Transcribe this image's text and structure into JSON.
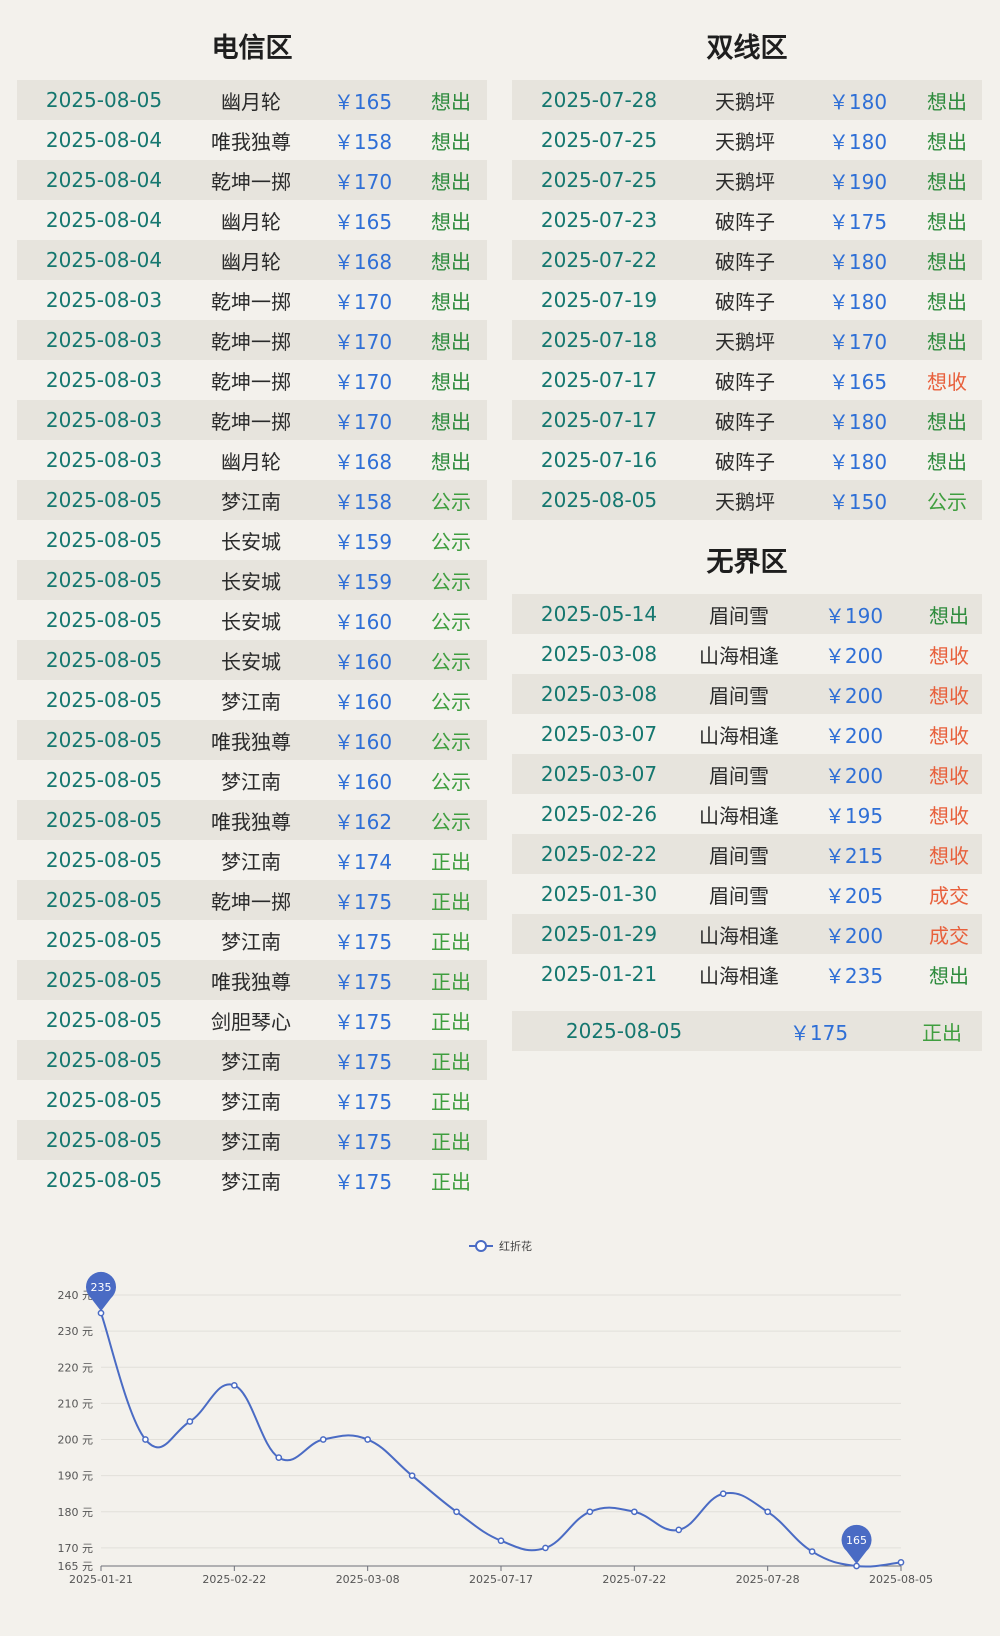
{
  "colors": {
    "date": "#15776f",
    "price": "#2f6fd6",
    "server": "#2a2a2a",
    "status_sell": "#2e8b3d",
    "status_public": "#3f9e3f",
    "status_buy": "#e8603c",
    "status_deal": "#e8603c",
    "series": "#4a6bc4"
  },
  "sections": {
    "dianxin": {
      "title": "电信区",
      "rows": [
        {
          "date": "2025-08-05",
          "server": "幽月轮",
          "price": "￥165",
          "status": "想出"
        },
        {
          "date": "2025-08-04",
          "server": "唯我独尊",
          "price": "￥158",
          "status": "想出"
        },
        {
          "date": "2025-08-04",
          "server": "乾坤一掷",
          "price": "￥170",
          "status": "想出"
        },
        {
          "date": "2025-08-04",
          "server": "幽月轮",
          "price": "￥165",
          "status": "想出"
        },
        {
          "date": "2025-08-04",
          "server": "幽月轮",
          "price": "￥168",
          "status": "想出"
        },
        {
          "date": "2025-08-03",
          "server": "乾坤一掷",
          "price": "￥170",
          "status": "想出"
        },
        {
          "date": "2025-08-03",
          "server": "乾坤一掷",
          "price": "￥170",
          "status": "想出"
        },
        {
          "date": "2025-08-03",
          "server": "乾坤一掷",
          "price": "￥170",
          "status": "想出"
        },
        {
          "date": "2025-08-03",
          "server": "乾坤一掷",
          "price": "￥170",
          "status": "想出"
        },
        {
          "date": "2025-08-03",
          "server": "幽月轮",
          "price": "￥168",
          "status": "想出"
        },
        {
          "date": "2025-08-05",
          "server": "梦江南",
          "price": "￥158",
          "status": "公示"
        },
        {
          "date": "2025-08-05",
          "server": "长安城",
          "price": "￥159",
          "status": "公示"
        },
        {
          "date": "2025-08-05",
          "server": "长安城",
          "price": "￥159",
          "status": "公示"
        },
        {
          "date": "2025-08-05",
          "server": "长安城",
          "price": "￥160",
          "status": "公示"
        },
        {
          "date": "2025-08-05",
          "server": "长安城",
          "price": "￥160",
          "status": "公示"
        },
        {
          "date": "2025-08-05",
          "server": "梦江南",
          "price": "￥160",
          "status": "公示"
        },
        {
          "date": "2025-08-05",
          "server": "唯我独尊",
          "price": "￥160",
          "status": "公示"
        },
        {
          "date": "2025-08-05",
          "server": "梦江南",
          "price": "￥160",
          "status": "公示"
        },
        {
          "date": "2025-08-05",
          "server": "唯我独尊",
          "price": "￥162",
          "status": "公示"
        },
        {
          "date": "2025-08-05",
          "server": "梦江南",
          "price": "￥174",
          "status": "正出"
        },
        {
          "date": "2025-08-05",
          "server": "乾坤一掷",
          "price": "￥175",
          "status": "正出"
        },
        {
          "date": "2025-08-05",
          "server": "梦江南",
          "price": "￥175",
          "status": "正出"
        },
        {
          "date": "2025-08-05",
          "server": "唯我独尊",
          "price": "￥175",
          "status": "正出"
        },
        {
          "date": "2025-08-05",
          "server": "剑胆琴心",
          "price": "￥175",
          "status": "正出"
        },
        {
          "date": "2025-08-05",
          "server": "梦江南",
          "price": "￥175",
          "status": "正出"
        },
        {
          "date": "2025-08-05",
          "server": "梦江南",
          "price": "￥175",
          "status": "正出"
        },
        {
          "date": "2025-08-05",
          "server": "梦江南",
          "price": "￥175",
          "status": "正出"
        },
        {
          "date": "2025-08-05",
          "server": "梦江南",
          "price": "￥175",
          "status": "正出"
        }
      ]
    },
    "shuangxian": {
      "title": "双线区",
      "rows": [
        {
          "date": "2025-07-28",
          "server": "天鹅坪",
          "price": "￥180",
          "status": "想出"
        },
        {
          "date": "2025-07-25",
          "server": "天鹅坪",
          "price": "￥180",
          "status": "想出"
        },
        {
          "date": "2025-07-25",
          "server": "天鹅坪",
          "price": "￥190",
          "status": "想出"
        },
        {
          "date": "2025-07-23",
          "server": "破阵子",
          "price": "￥175",
          "status": "想出"
        },
        {
          "date": "2025-07-22",
          "server": "破阵子",
          "price": "￥180",
          "status": "想出"
        },
        {
          "date": "2025-07-19",
          "server": "破阵子",
          "price": "￥180",
          "status": "想出"
        },
        {
          "date": "2025-07-18",
          "server": "天鹅坪",
          "price": "￥170",
          "status": "想出"
        },
        {
          "date": "2025-07-17",
          "server": "破阵子",
          "price": "￥165",
          "status": "想收"
        },
        {
          "date": "2025-07-17",
          "server": "破阵子",
          "price": "￥180",
          "status": "想出"
        },
        {
          "date": "2025-07-16",
          "server": "破阵子",
          "price": "￥180",
          "status": "想出"
        },
        {
          "date": "2025-08-05",
          "server": "天鹅坪",
          "price": "￥150",
          "status": "公示"
        }
      ]
    },
    "wujie": {
      "title": "无界区",
      "rows": [
        {
          "date": "2025-05-14",
          "server": "眉间雪",
          "price": "￥190",
          "status": "想出"
        },
        {
          "date": "2025-03-08",
          "server": "山海相逢",
          "price": "￥200",
          "status": "想收"
        },
        {
          "date": "2025-03-08",
          "server": "眉间雪",
          "price": "￥200",
          "status": "想收"
        },
        {
          "date": "2025-03-07",
          "server": "山海相逢",
          "price": "￥200",
          "status": "想收"
        },
        {
          "date": "2025-03-07",
          "server": "眉间雪",
          "price": "￥200",
          "status": "想收"
        },
        {
          "date": "2025-02-26",
          "server": "山海相逢",
          "price": "￥195",
          "status": "想收"
        },
        {
          "date": "2025-02-22",
          "server": "眉间雪",
          "price": "￥215",
          "status": "想收"
        },
        {
          "date": "2025-01-30",
          "server": "眉间雪",
          "price": "￥205",
          "status": "成交"
        },
        {
          "date": "2025-01-29",
          "server": "山海相逢",
          "price": "￥200",
          "status": "成交"
        },
        {
          "date": "2025-01-21",
          "server": "山海相逢",
          "price": "￥235",
          "status": "想出"
        }
      ],
      "summary": {
        "date": "2025-08-05",
        "price": "￥175",
        "status": "正出"
      }
    }
  },
  "chart_data": {
    "type": "line",
    "legend": [
      "红折花"
    ],
    "legend_position": "top-center",
    "series": [
      {
        "name": "红折花",
        "values": [
          235,
          200,
          205,
          215,
          195,
          200,
          200,
          190,
          180,
          172,
          170,
          180,
          180,
          175,
          185,
          180,
          169,
          165,
          166
        ]
      }
    ],
    "x_tick_labels": [
      "2025-01-21",
      "2025-02-22",
      "2025-03-08",
      "2025-07-17",
      "2025-07-22",
      "2025-07-28",
      "2025-08-05"
    ],
    "x_tick_indices": [
      0,
      3,
      6,
      9,
      12,
      15,
      18
    ],
    "y_ticks": [
      165,
      170,
      180,
      190,
      200,
      210,
      220,
      230,
      240
    ],
    "y_tick_labels": [
      "165 元",
      "170 元",
      "180 元",
      "190 元",
      "200 元",
      "210 元",
      "220 元",
      "230 元",
      "240 元"
    ],
    "ylim": [
      165,
      240
    ],
    "markers": [
      {
        "index": 0,
        "label": "235"
      },
      {
        "index": 17,
        "label": "165"
      }
    ],
    "grid": true,
    "smooth": true
  }
}
